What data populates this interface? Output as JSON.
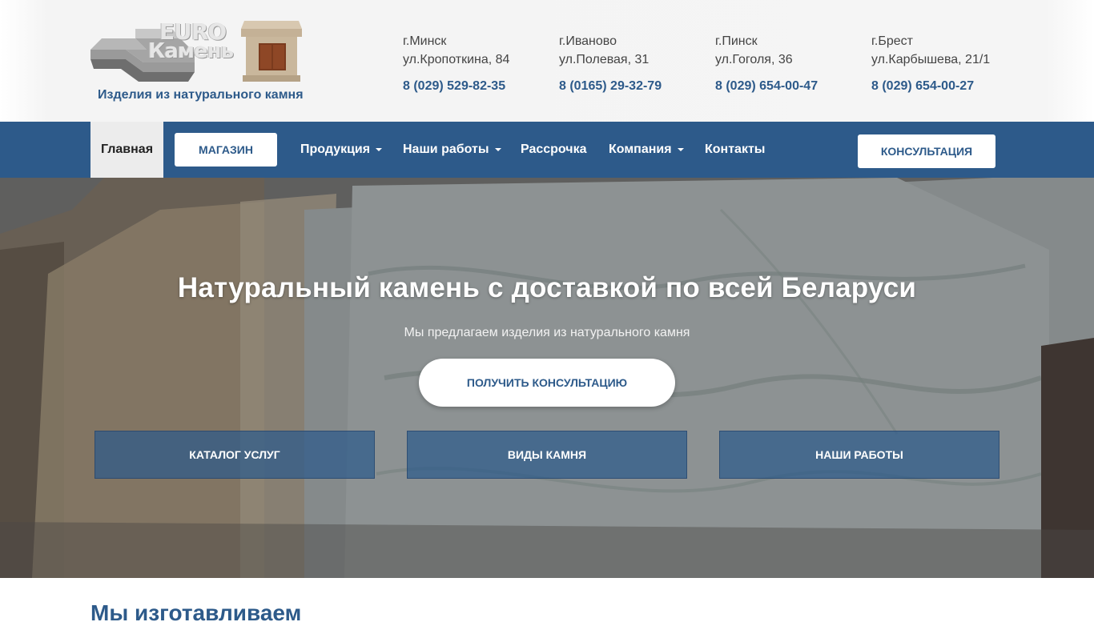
{
  "header": {
    "logo": {
      "line1": "EURO",
      "line2": "Камень"
    },
    "tagline": "Изделия из натурального камня",
    "contacts": [
      {
        "city": "г.Минск",
        "street": "ул.Кропоткина, 84",
        "phone": "8 (029) 529-82-35"
      },
      {
        "city": "г.Иваново",
        "street": "ул.Полевая, 31",
        "phone": "8 (0165) 29-32-79"
      },
      {
        "city": "г.Пинск",
        "street": "ул.Гоголя, 36",
        "phone": "8 (029) 654-00-47"
      },
      {
        "city": "г.Брест",
        "street": "ул.Карбышева, 21/1",
        "phone": "8 (029) 654-00-27"
      }
    ]
  },
  "nav": {
    "home": "Главная",
    "shop": "МАГАЗИН",
    "products": "Продукция",
    "works": "Наши работы",
    "installment": "Рассрочка",
    "company": "Компания",
    "contacts": "Контакты",
    "consult": "КОНСУЛЬТАЦИЯ"
  },
  "hero": {
    "title": "Натуральный камень с доставкой по всей Беларуси",
    "subtitle": "Мы предлагаем изделия из натурального камня",
    "cta": "ПОЛУЧИТЬ КОНСУЛЬТАЦИЮ",
    "tiles": [
      "КАТАЛОГ УСЛУГ",
      "ВИДЫ КАМНЯ",
      "НАШИ РАБОТЫ"
    ]
  },
  "section": {
    "title": "Мы изготавливаем"
  },
  "colors": {
    "brand": "#2d5a8a",
    "nav_active_bg": "#ececec",
    "white": "#ffffff"
  }
}
